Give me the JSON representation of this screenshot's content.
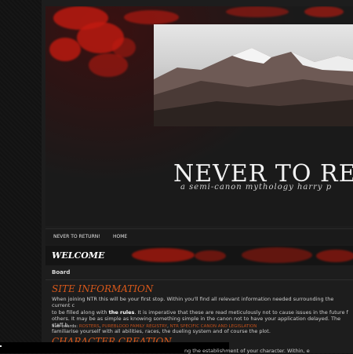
{
  "banner": {
    "title": "NEVER TO RET",
    "tagline": "a semi-canon mythology harry p"
  },
  "nav": {
    "items": [
      {
        "label": "NEVER TO RETURN!"
      },
      {
        "label": "HOME"
      }
    ]
  },
  "category": {
    "title": "WELCOME",
    "board_label": "Board"
  },
  "forums": [
    {
      "title": "SITE INFORMATION",
      "description_parts": [
        "When joining NTR this will be your first stop. Within you'll find all relevant information needed surrounding the current c",
        " to be filled along with ",
        "the rules",
        ". It is imperative that these are read meticulously not to cause issues in the future f",
        " others. It may be as simple as knowing something simple in the canon not to have your application delayed. The staff b",
        " familiarise yourself with all abilities, races, the dueling system and of course the plot."
      ],
      "subboards_label": "Sub-boards:",
      "subboards": [
        "ROSTERS",
        "PUREBLOOD FAMILY REGISTRY",
        "NTR SPECIFIC CANON AND LEGISLATION"
      ]
    },
    {
      "title": "CHARACTER CREATION",
      "description": "ng the establishment of your character. Within, e"
    }
  ],
  "colors": {
    "accent": "#d8581a",
    "link": "#c14f1a",
    "background": "#1d1d1d",
    "banner_red": "#c21a10"
  }
}
